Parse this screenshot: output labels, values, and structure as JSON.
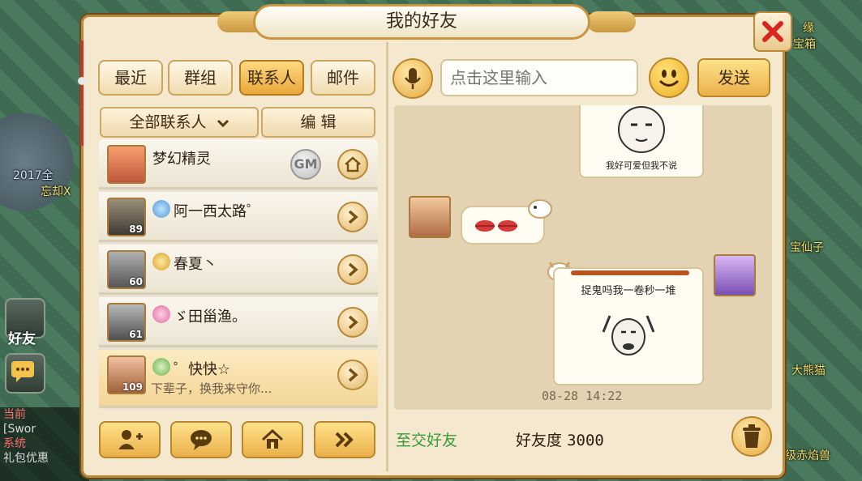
{
  "window": {
    "title": "我的好友"
  },
  "tabs": [
    {
      "label": "最近",
      "active": false
    },
    {
      "label": "群组",
      "active": false
    },
    {
      "label": "联系人",
      "active": true
    },
    {
      "label": "邮件",
      "active": false
    }
  ],
  "filter": {
    "dropdown_label": "全部联系人",
    "edit_label": "编  辑"
  },
  "contacts": [
    {
      "name": "梦幻精灵",
      "level": "",
      "badge": "GM",
      "signature": "",
      "highlight": false
    },
    {
      "name": "阿一西太路゜",
      "level": "89",
      "signature": "",
      "highlight": false
    },
    {
      "name": "春夏丶",
      "level": "60",
      "signature": "",
      "highlight": false
    },
    {
      "name": "ゞ田甾渔。",
      "level": "61",
      "signature": "",
      "highlight": false
    },
    {
      "name": "゜快快☆",
      "level": "109",
      "signature": "下辈子，换我来守你...",
      "highlight": true
    }
  ],
  "input": {
    "placeholder": "点击这里输入"
  },
  "send_label": "发送",
  "messages": [
    {
      "from": "me",
      "text": "我好可爱但我不说",
      "type": "sticker"
    },
    {
      "from": "friend",
      "text": "",
      "type": "sticker-lips"
    },
    {
      "from": "me",
      "text": "捉鬼吗我一卷秒一堆",
      "type": "text+sticker"
    }
  ],
  "timestamp": "08-28  14:22",
  "footer": {
    "relation": "至交好友",
    "intimacy_label": "好友度",
    "intimacy_value": "3000"
  },
  "background": {
    "hud_friends": "好友",
    "left_texts": [
      "2017全",
      "忘却X",
      "当前",
      "[Swor",
      "系统",
      "礼包优惠"
    ],
    "right_texts": [
      "缘",
      "宝箱",
      "宝仙子",
      "大熊猫",
      "级赤焰兽"
    ]
  },
  "colors": {
    "accent": "#e9a83a",
    "panel": "#f4e9cf",
    "relation_green": "#3a9a3a"
  }
}
